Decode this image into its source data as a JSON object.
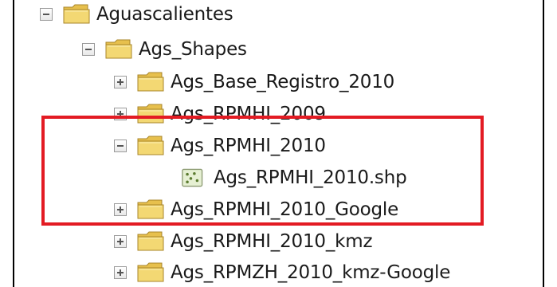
{
  "tree": {
    "items": [
      {
        "label": "Aguascalientes",
        "state": "expanded",
        "icon": "folder-icon"
      },
      {
        "label": "Ags_Shapes",
        "state": "expanded",
        "icon": "folder-icon"
      },
      {
        "label": "Ags_Base_Registro_2010",
        "state": "collapsed",
        "icon": "folder-icon"
      },
      {
        "label": "Ags_RPMHI_2009",
        "state": "collapsed",
        "icon": "folder-icon"
      },
      {
        "label": "Ags_RPMHI_2010",
        "state": "expanded",
        "icon": "folder-icon"
      },
      {
        "label": "Ags_RPMHI_2010.shp",
        "state": "leaf",
        "icon": "point-shapefile-icon"
      },
      {
        "label": "Ags_RPMHI_2010_Google",
        "state": "collapsed",
        "icon": "folder-icon"
      },
      {
        "label": "Ags_RPMHI_2010_kmz",
        "state": "collapsed",
        "icon": "folder-icon"
      },
      {
        "label": "Ags_RPMZH_2010_kmz-Google",
        "state": "collapsed",
        "icon": "folder-icon"
      }
    ]
  },
  "colors": {
    "highlight": "#e31b23",
    "folder_fill": "#f3d873",
    "text": "#1a1a1a"
  }
}
